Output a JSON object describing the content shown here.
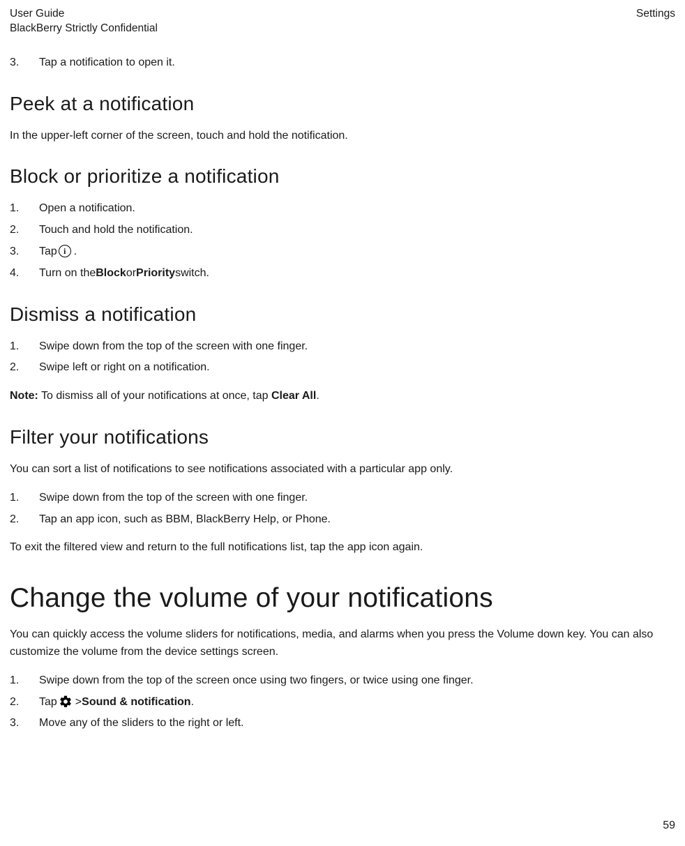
{
  "header": {
    "line1": "User Guide",
    "line2": "BlackBerry Strictly Confidential",
    "right": "Settings"
  },
  "introStep": {
    "num": "3.",
    "text": "Tap a notification to open it."
  },
  "peek": {
    "title": "Peek at a notification",
    "para": "In the upper-left corner of the screen, touch and hold the notification."
  },
  "block": {
    "title": "Block or prioritize a notification",
    "steps": {
      "s1": {
        "num": "1.",
        "text": "Open a notification."
      },
      "s2": {
        "num": "2.",
        "text": "Touch and hold the notification."
      },
      "s3": {
        "num": "3.",
        "pre": "Tap ",
        "post": " ."
      },
      "s4": {
        "num": "4.",
        "pre": "Turn on the ",
        "b1": "Block",
        "mid": " or ",
        "b2": "Priority",
        "post": " switch."
      }
    }
  },
  "dismiss": {
    "title": "Dismiss a notification",
    "steps": {
      "s1": {
        "num": "1.",
        "text": "Swipe down from the top of the screen with one finger."
      },
      "s2": {
        "num": "2.",
        "text": "Swipe left or right on a notification."
      }
    },
    "note": {
      "label": "Note:",
      "pre": " To dismiss all of your notifications at once, tap ",
      "b": "Clear All",
      "post": "."
    }
  },
  "filter": {
    "title": "Filter your notifications",
    "intro": "You can sort a list of notifications to see notifications associated with a particular app only.",
    "steps": {
      "s1": {
        "num": "1.",
        "text": "Swipe down from the top of the screen with one finger."
      },
      "s2": {
        "num": "2.",
        "text": "Tap an app icon, such as BBM, BlackBerry Help, or Phone."
      }
    },
    "outro": "To exit the filtered view and return to the full notifications list, tap the app icon again."
  },
  "volume": {
    "title": "Change the volume of your notifications",
    "intro": "You can quickly access the volume sliders for notifications, media, and alarms when you press the Volume down key. You can also customize the volume from the device settings screen.",
    "steps": {
      "s1": {
        "num": "1.",
        "text": "Swipe down from the top of the screen once using two fingers, or twice using one finger."
      },
      "s2": {
        "num": "2.",
        "pre": "Tap ",
        "gt": " > ",
        "b": "Sound & notification",
        "post": "."
      },
      "s3": {
        "num": "3.",
        "text": "Move any of the sliders to the right or left."
      }
    }
  },
  "pageNumber": "59",
  "icons": {
    "info": "i"
  }
}
